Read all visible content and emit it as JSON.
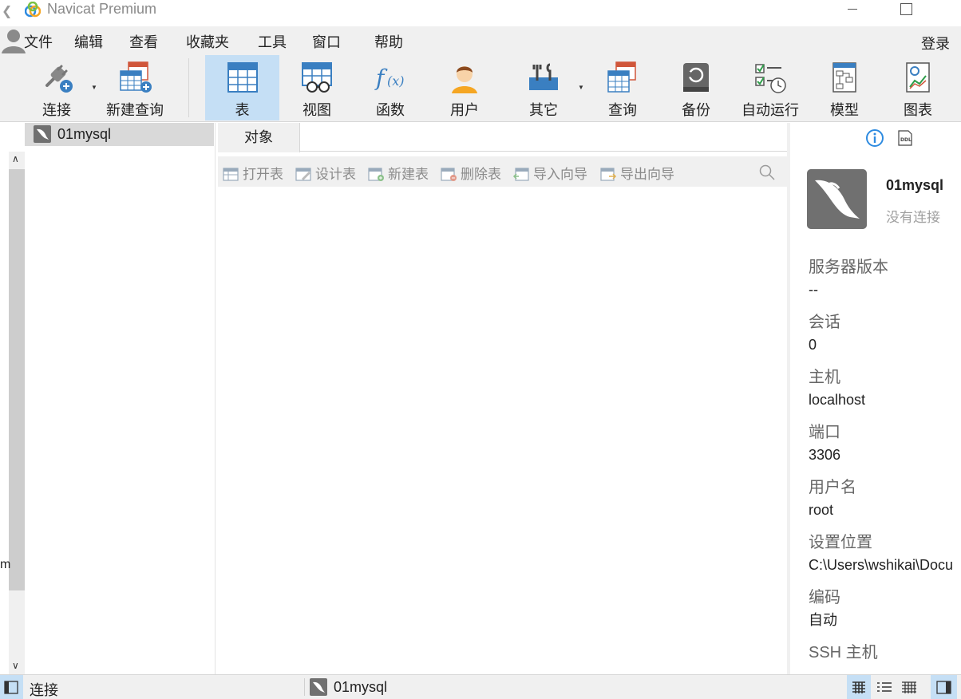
{
  "window": {
    "title": "Navicat Premium"
  },
  "menu": {
    "items": [
      "文件",
      "编辑",
      "查看",
      "收藏夹",
      "工具",
      "窗口",
      "帮助"
    ],
    "login": "登录"
  },
  "toolbar": {
    "connect": "连接",
    "new_query": "新建查询",
    "table": "表",
    "view": "视图",
    "function": "函数",
    "user": "用户",
    "others": "其它",
    "query": "查询",
    "backup": "备份",
    "automation": "自动运行",
    "model": "模型",
    "chart": "图表"
  },
  "navigator": {
    "connection": "01mysql"
  },
  "objects": {
    "tab_label": "对象",
    "actions": {
      "open_table": "打开表",
      "design_table": "设计表",
      "new_table": "新建表",
      "delete_table": "删除表",
      "import_wizard": "导入向导",
      "export_wizard": "导出向导"
    }
  },
  "info": {
    "name": "01mysql",
    "status": "没有连接",
    "fields": [
      {
        "label": "服务器版本",
        "value": "--"
      },
      {
        "label": "会话",
        "value": "0"
      },
      {
        "label": "主机",
        "value": "localhost"
      },
      {
        "label": "端口",
        "value": "3306"
      },
      {
        "label": "用户名",
        "value": "root"
      },
      {
        "label": "设置位置",
        "value": "C:\\Users\\wshikai\\Docu"
      },
      {
        "label": "编码",
        "value": "自动"
      },
      {
        "label": "SSH 主机",
        "value": ""
      }
    ]
  },
  "statusbar": {
    "left_label": "连接",
    "connection": "01mysql"
  },
  "colors": {
    "active_bg": "#c5dff5",
    "chrome_bg": "#f0f0f0",
    "accent_blue": "#3a7fc1"
  }
}
